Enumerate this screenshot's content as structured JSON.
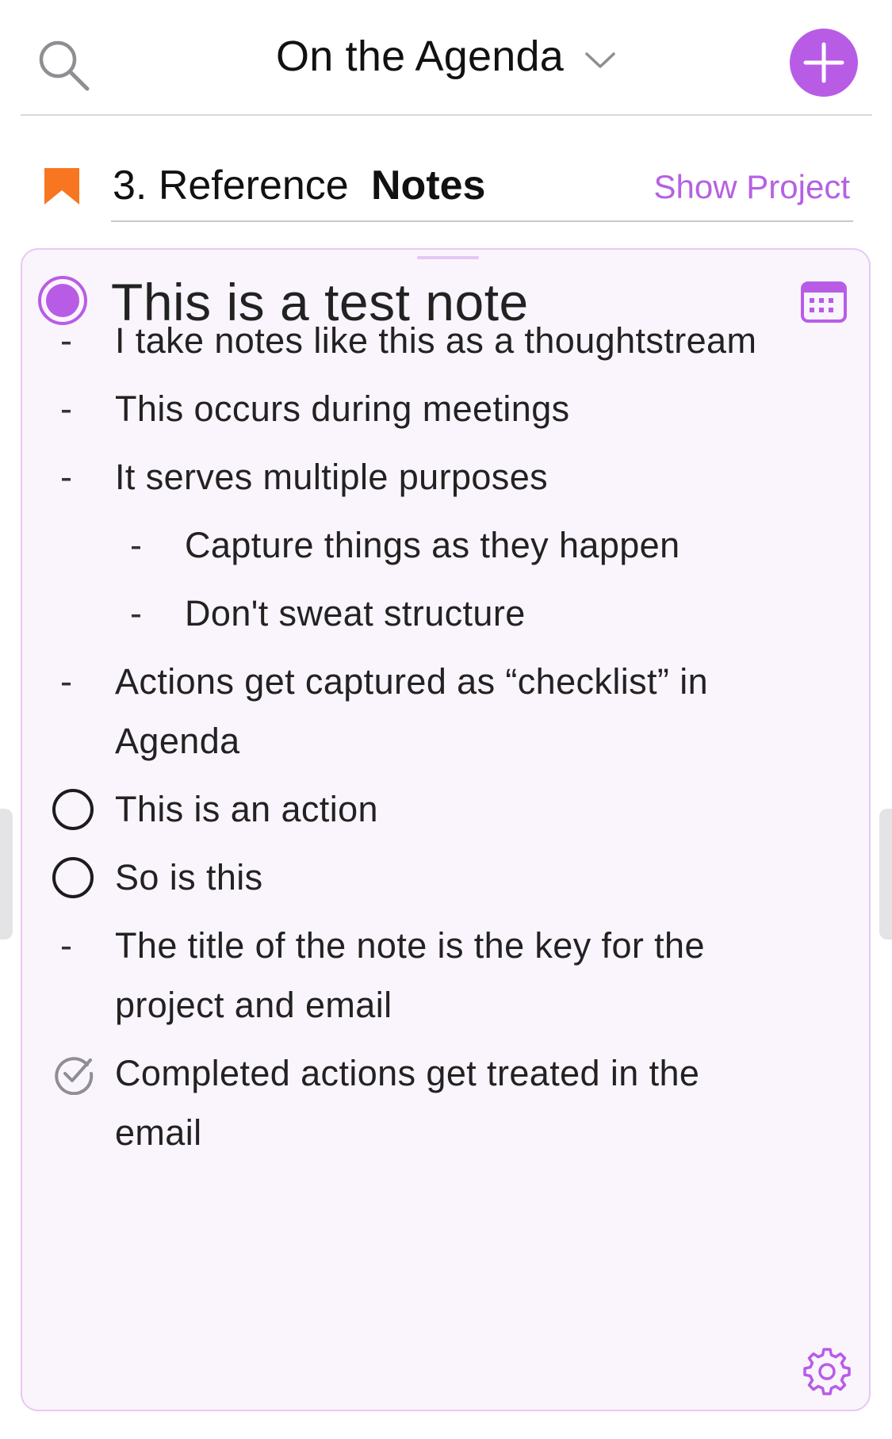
{
  "header": {
    "title": "On the Agenda",
    "icons": {
      "search": "search-icon",
      "dropdown": "chevron-down-icon",
      "add": "plus-icon"
    },
    "accent_color": "#b85ce6"
  },
  "project": {
    "name": "3. Reference",
    "note_label": "Notes",
    "show_project_label": "Show Project",
    "bookmark_color": "#f7761f"
  },
  "note": {
    "title": "This is a test note",
    "status_color": "#b85ce6",
    "lines": [
      {
        "kind": "bullet",
        "level": 0,
        "text": "I take notes like this as a thoughtstream"
      },
      {
        "kind": "bullet",
        "level": 0,
        "text": "This occurs during meetings"
      },
      {
        "kind": "bullet",
        "level": 0,
        "text": "It serves multiple purposes"
      },
      {
        "kind": "bullet",
        "level": 1,
        "text": "Capture things as they happen"
      },
      {
        "kind": "bullet",
        "level": 1,
        "text": "Don't sweat structure"
      },
      {
        "kind": "bullet",
        "level": 0,
        "text": "Actions get captured as “checklist” in",
        "cont": "Agenda"
      },
      {
        "kind": "action",
        "level": 0,
        "done": false,
        "text": "This is an action"
      },
      {
        "kind": "action",
        "level": 0,
        "done": false,
        "text": "So is this"
      },
      {
        "kind": "bullet",
        "level": 0,
        "text": "The title of the note is the key for the",
        "cont": "project and email"
      },
      {
        "kind": "action",
        "level": 0,
        "done": true,
        "text": "Completed actions get treated in the",
        "cont": "email"
      }
    ],
    "bullet_glyph": "-"
  }
}
